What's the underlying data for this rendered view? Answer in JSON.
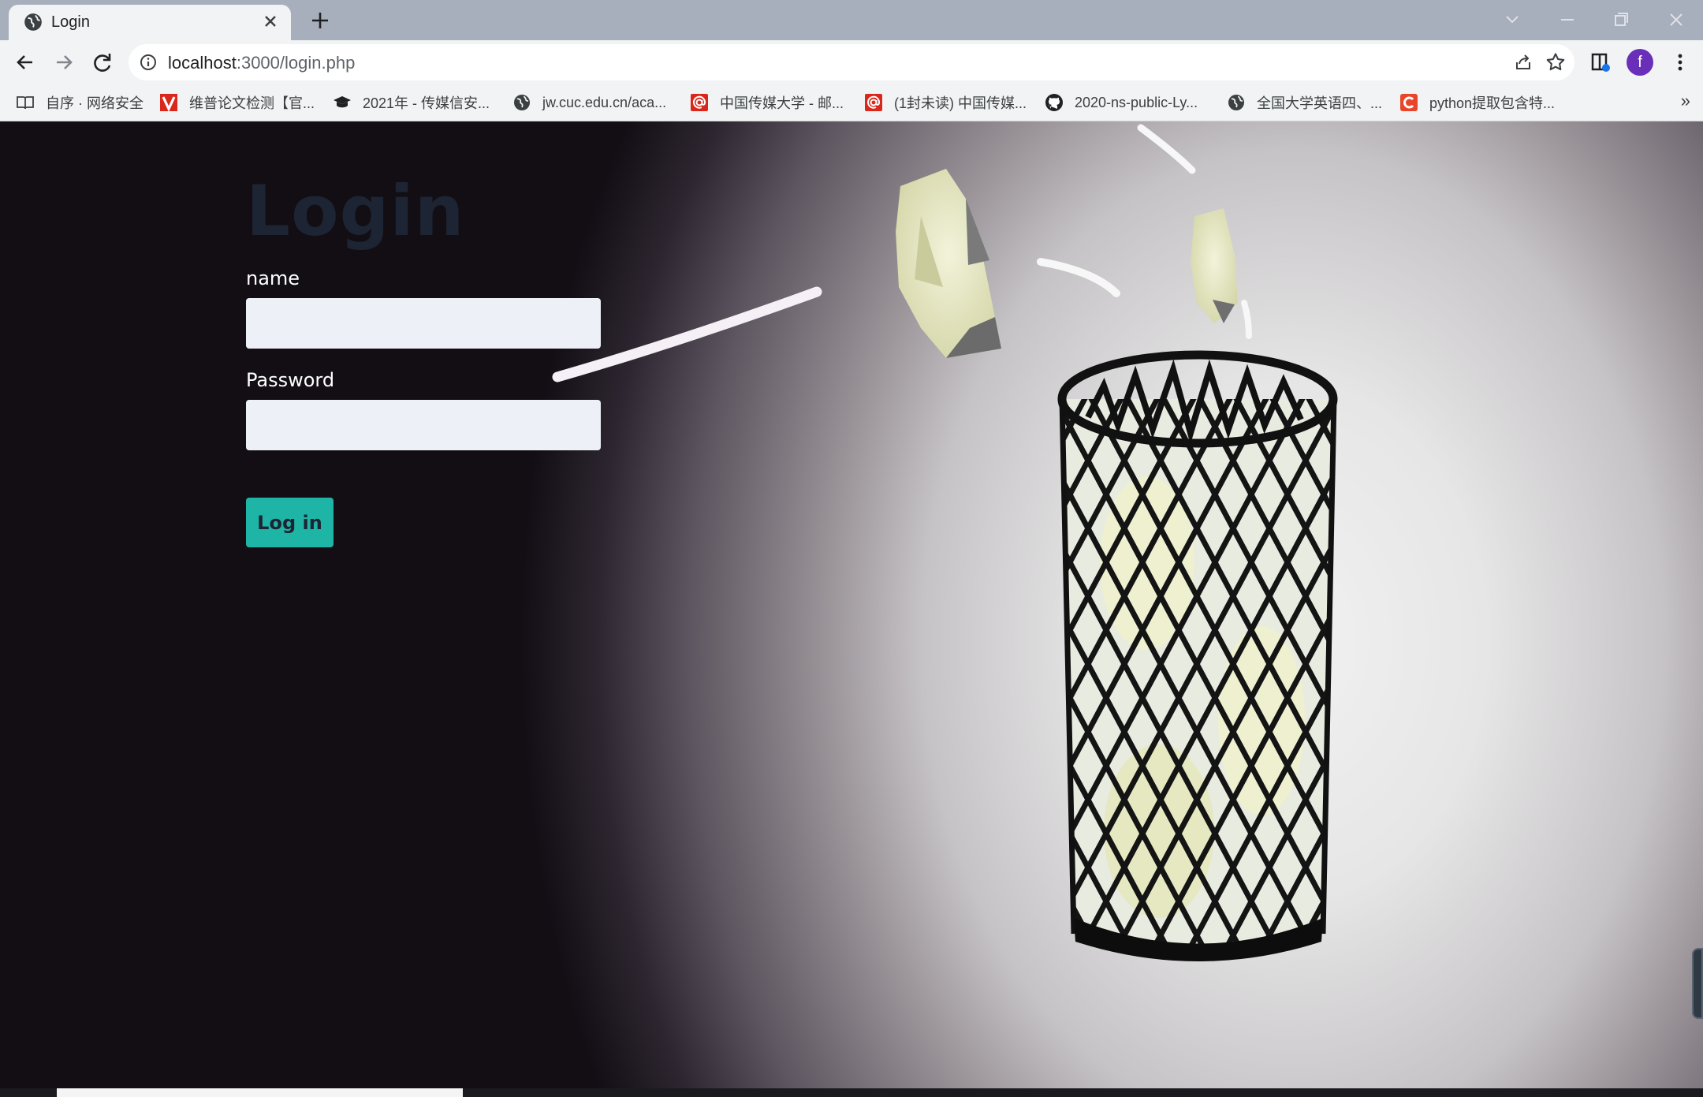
{
  "browser": {
    "tab": {
      "title": "Login"
    },
    "address": {
      "host": "localhost",
      "rest": ":3000/login.php"
    },
    "profile_initial": "f"
  },
  "bookmarks": [
    {
      "label": "自序 · 网络安全",
      "icon": "book-icon"
    },
    {
      "label": "维普论文检测【官...",
      "icon": "vip-logo-icon"
    },
    {
      "label": "2021年 - 传媒信安...",
      "icon": "graduation-cap-icon"
    },
    {
      "label": "jw.cuc.edu.cn/aca...",
      "icon": "globe-icon"
    },
    {
      "label": "中国传媒大学 - 邮...",
      "icon": "mail-at-icon"
    },
    {
      "label": "(1封未读) 中国传媒...",
      "icon": "mail-at-icon"
    },
    {
      "label": "2020-ns-public-Ly...",
      "icon": "github-icon"
    },
    {
      "label": "全国大学英语四、...",
      "icon": "globe-icon"
    },
    {
      "label": "python提取包含特...",
      "icon": "csdn-logo-icon"
    }
  ],
  "bookmarks_more": "»",
  "login": {
    "heading": "Login",
    "name_label": "name",
    "name_value": "",
    "password_label": "Password",
    "password_value": "",
    "submit_label": "Log in"
  },
  "colors": {
    "heading": "#1d2433",
    "button": "#1fb5a6",
    "input_bg": "#eef0f7",
    "profile": "#6a2fb8"
  }
}
